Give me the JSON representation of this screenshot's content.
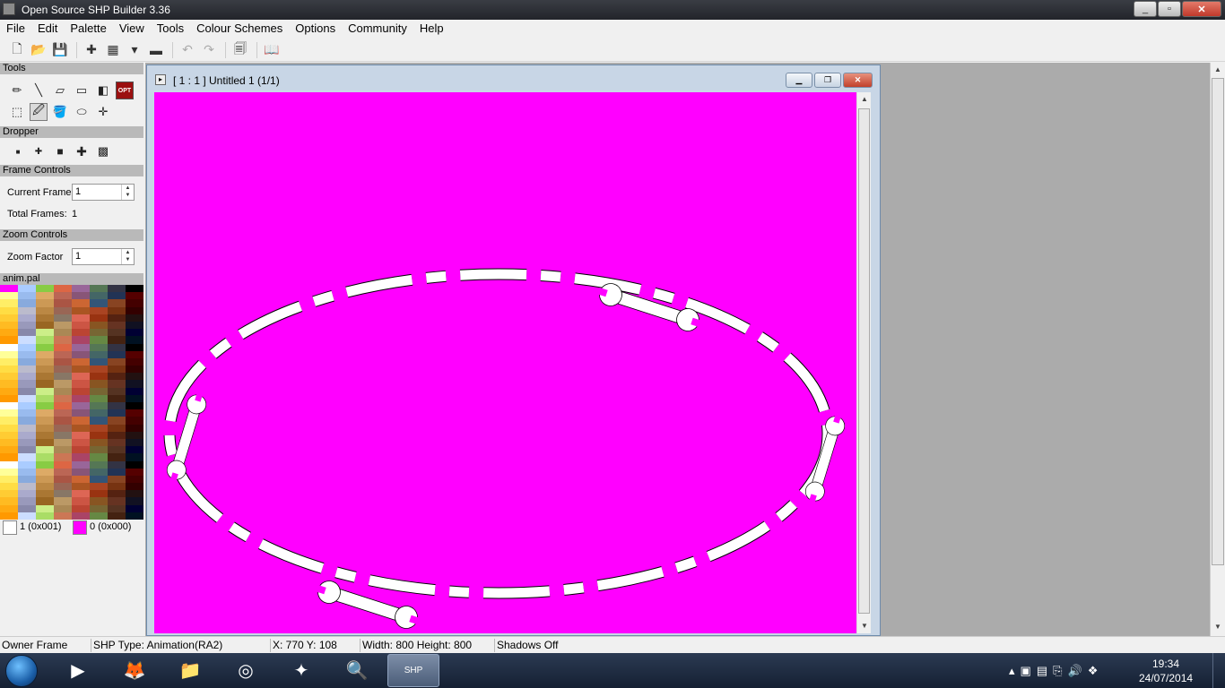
{
  "app": {
    "title": "Open Source SHP Builder 3.36",
    "window_controls": [
      "minimize",
      "maximize",
      "close"
    ]
  },
  "menu": [
    "File",
    "Edit",
    "Palette",
    "View",
    "Tools",
    "Colour Schemes",
    "Options",
    "Community",
    "Help"
  ],
  "toolbar": {
    "buttons": [
      "new-file-icon",
      "open-folder-icon",
      "save-icon",
      "add-frame-icon",
      "grid-icon",
      "dropdown-icon",
      "preview-icon",
      "undo-icon",
      "redo-icon",
      "properties-icon",
      "palette-book-icon"
    ]
  },
  "left_panel": {
    "tools_header": "Tools",
    "tools": [
      "pencil-icon",
      "line-icon",
      "eraser-icon",
      "rectangle-icon",
      "colour-swap-icon",
      "options-icon",
      "select-rect-icon",
      "dropper-icon",
      "fill-icon",
      "ellipse-icon",
      "move-icon"
    ],
    "options_label": "OPT",
    "dropper_header": "Dropper",
    "brush_sizes": [
      "brush-1-icon",
      "brush-2-icon",
      "brush-3-icon",
      "brush-4-icon",
      "brush-spray-icon"
    ],
    "frame_header": "Frame Controls",
    "current_frame_label": "Current Frame",
    "current_frame_value": "1",
    "total_frames_label": "Total Frames:",
    "total_frames_value": "1",
    "zoom_header": "Zoom Controls",
    "zoom_factor_label": "Zoom Factor",
    "zoom_factor_value": "1",
    "palette_name": "anim.pal",
    "primary_colour_label": "1 (0x001)",
    "secondary_colour_label": "0 (0x000)",
    "primary_colour": "#ffffff",
    "secondary_colour": "#ff00ff"
  },
  "document": {
    "title": "[ 1 : 1 ] Untitled 1 (1/1)",
    "background_colour": "#ff00ff",
    "controls": [
      "minimize",
      "restore",
      "close"
    ]
  },
  "status": {
    "owner": "Owner Frame",
    "shp_type": "SHP Type: Animation(RA2)",
    "coords": "X: 770 Y: 108",
    "size": "Width: 800 Height: 800",
    "shadows": "Shadows Off"
  },
  "taskbar": {
    "apps": [
      "windows-media-player-icon",
      "firefox-icon",
      "file-explorer-icon",
      "torrent-client-icon",
      "xcc-mixer-icon",
      "xcc-utilities-icon",
      "shp-builder-icon"
    ],
    "active_app_label": "SHP",
    "time": "19:34",
    "date": "24/07/2014"
  }
}
